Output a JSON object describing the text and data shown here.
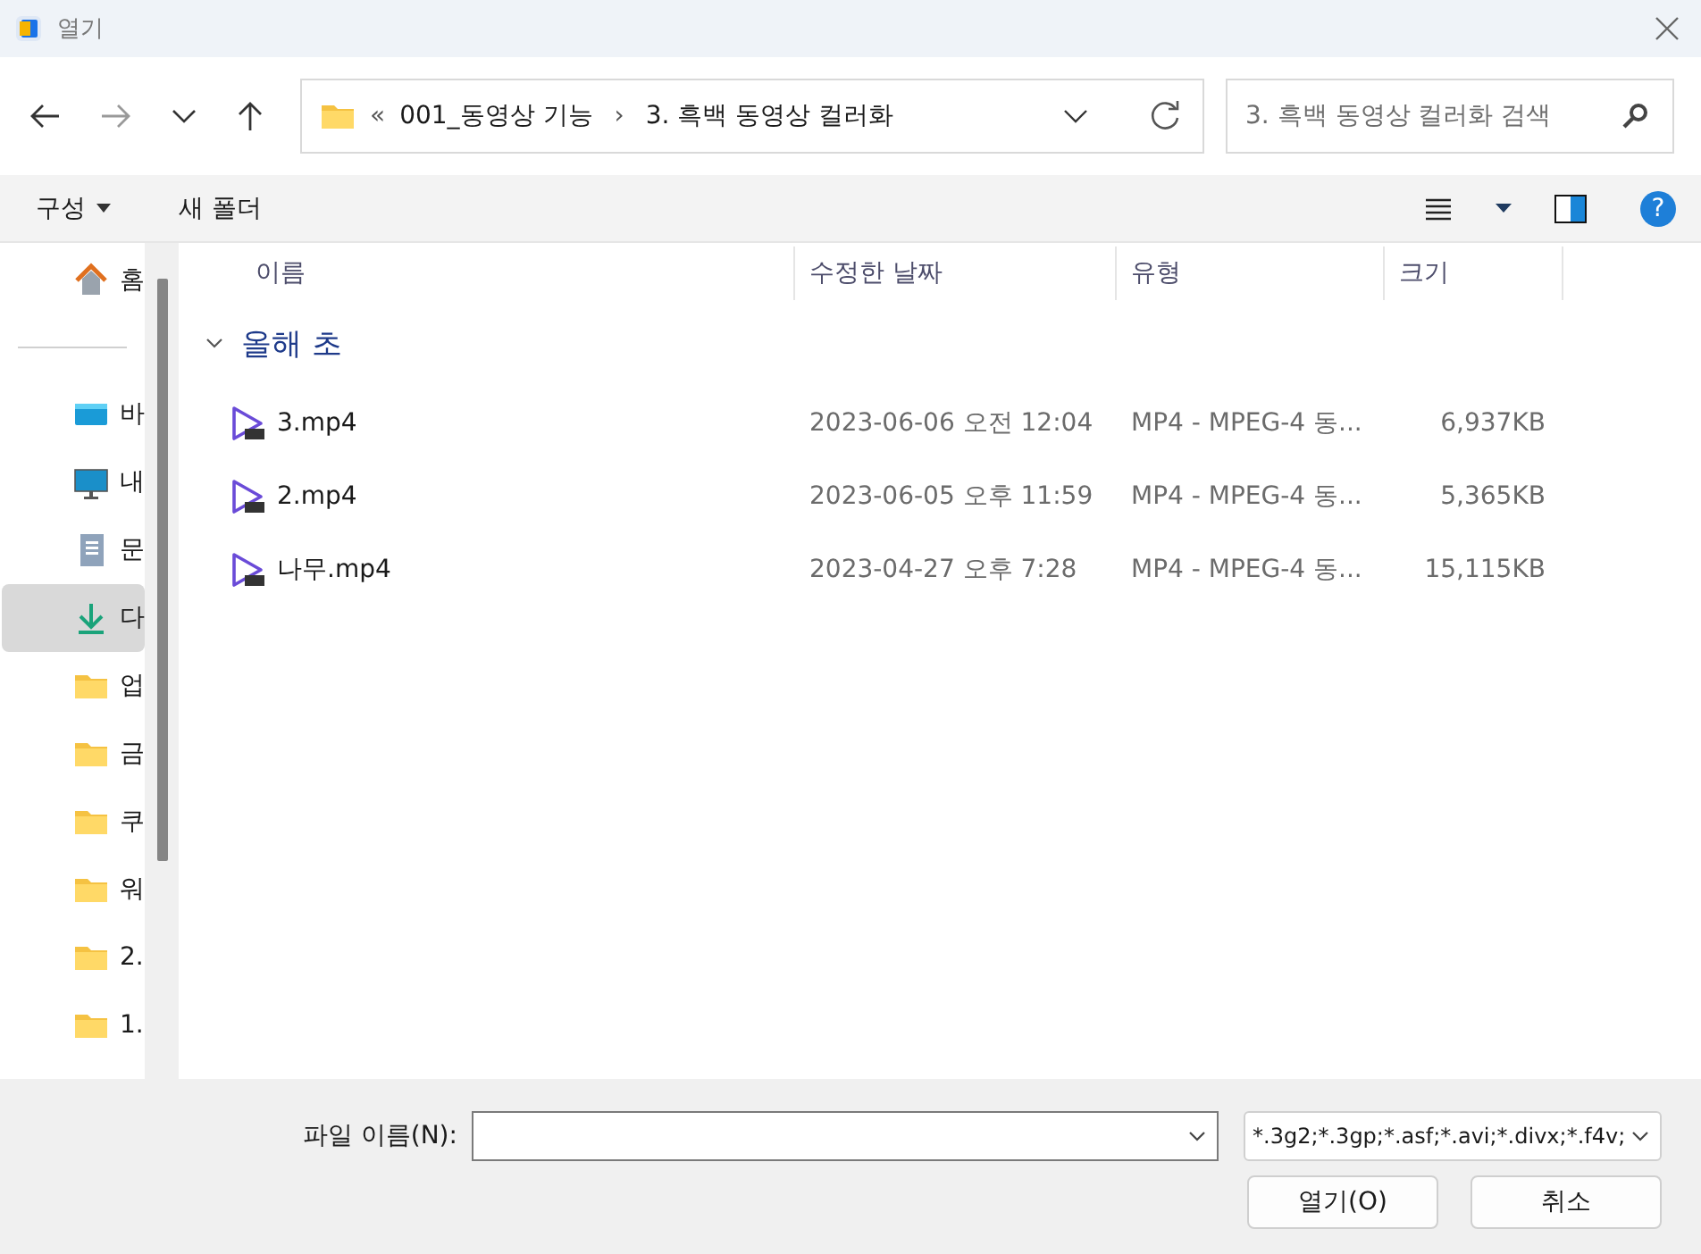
{
  "window": {
    "title": "열기"
  },
  "address": {
    "crumbs": [
      "«",
      "001_동영상 기능",
      "3. 흑백 동영상 컬러화"
    ],
    "separator": "›"
  },
  "search": {
    "placeholder": "3. 흑백 동영상 컬러화 검색"
  },
  "toolbar": {
    "organize": "구성",
    "new_folder": "새 폴더",
    "help": "?"
  },
  "sidebar": {
    "items": [
      {
        "label": "홈",
        "kind": "home",
        "selected": false
      },
      {
        "kind": "divider"
      },
      {
        "label": "바",
        "kind": "desktop",
        "selected": false
      },
      {
        "label": "내",
        "kind": "monitor",
        "selected": false
      },
      {
        "label": "문",
        "kind": "document",
        "selected": false
      },
      {
        "label": "다",
        "kind": "download",
        "selected": true
      },
      {
        "label": "업",
        "kind": "folder",
        "selected": false
      },
      {
        "label": "금",
        "kind": "folder",
        "selected": false
      },
      {
        "label": "쿠",
        "kind": "folder",
        "selected": false
      },
      {
        "label": "워",
        "kind": "folder",
        "selected": false
      },
      {
        "label": "2.",
        "kind": "folder",
        "selected": false
      },
      {
        "label": "1.",
        "kind": "folder",
        "selected": false
      }
    ]
  },
  "table": {
    "columns": [
      "이름",
      "수정한 날짜",
      "유형",
      "크기"
    ],
    "group": {
      "label": "올해 초",
      "expanded": true
    },
    "rows": [
      {
        "name": "3.mp4",
        "date": "2023-06-06 오전 12:04",
        "type": "MP4 - MPEG-4 동...",
        "size": "6,937KB"
      },
      {
        "name": "2.mp4",
        "date": "2023-06-05 오후 11:59",
        "type": "MP4 - MPEG-4 동...",
        "size": "5,365KB"
      },
      {
        "name": "나무.mp4",
        "date": "2023-04-27 오후 7:28",
        "type": "MP4 - MPEG-4 동...",
        "size": "15,115KB"
      }
    ]
  },
  "footer": {
    "filename_label": "파일 이름(N):",
    "filter": "*.3g2;*.3gp;*.asf;*.avi;*.divx;*.f4v;",
    "open": "열기(O)",
    "cancel": "취소"
  }
}
